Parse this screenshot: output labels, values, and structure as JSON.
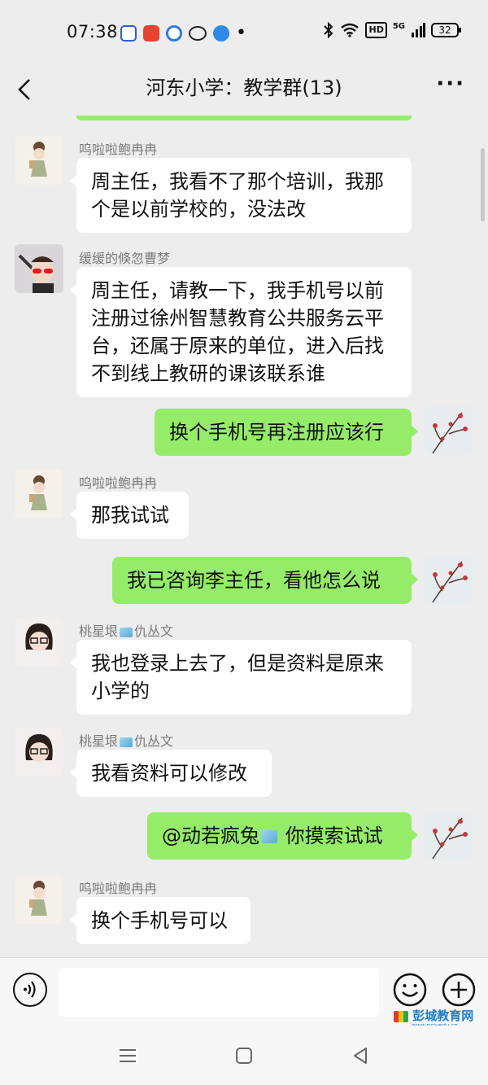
{
  "status_bar": {
    "time": "07:38",
    "app_icons": [
      "baidu-icon",
      "listen-app-icon",
      "browser-icon",
      "messaging-icon",
      "qq-browser-icon"
    ],
    "dot": "•",
    "network": "5G",
    "hd": "HD",
    "battery": "32"
  },
  "header": {
    "title": "河东小学：教学群(13)",
    "more": "···"
  },
  "messages": [
    {
      "direction": "in",
      "sender": "呜啦啦鲍冉冉",
      "text": "周主任，我看不了那个培训，我那个是以前学校的，没法改"
    },
    {
      "direction": "in",
      "sender": "缓缓的倏忽曹梦",
      "text": "周主任，请教一下，我手机号以前注册过徐州智慧教育公共服务云平台，还属于原来的单位，进入后找不到线上教研的课该联系谁"
    },
    {
      "direction": "out",
      "text": "换个手机号再注册应该行"
    },
    {
      "direction": "in",
      "sender": "呜啦啦鲍冉冉",
      "text": "那我试试"
    },
    {
      "direction": "out",
      "text": "我已咨询李主任，看他怎么说"
    },
    {
      "direction": "in",
      "sender_pre": "桃星垠",
      "sender_post": "仇丛文",
      "text": "我也登录上去了，但是资料是原来小学的"
    },
    {
      "direction": "in",
      "sender_pre": "桃星垠",
      "sender_post": "仇丛文",
      "text": "我看资料可以修改"
    },
    {
      "direction": "out",
      "mention": "@动若疯兔",
      "text": " 你摸索试试"
    },
    {
      "direction": "in",
      "sender": "呜啦啦鲍冉冉",
      "text": "换个手机号可以"
    }
  ],
  "input_bar": {
    "voice_icon": "voice-icon",
    "emoji_icon": "emoji-icon",
    "plus_icon": "plus-icon"
  },
  "watermark": {
    "name": "彭城教育网",
    "url": "www.pcjyedu.cn"
  },
  "colors": {
    "background": "#ededed",
    "outgoing_bubble": "#95ec69",
    "incoming_bubble": "#ffffff",
    "sender_name": "#7a7a7a"
  }
}
